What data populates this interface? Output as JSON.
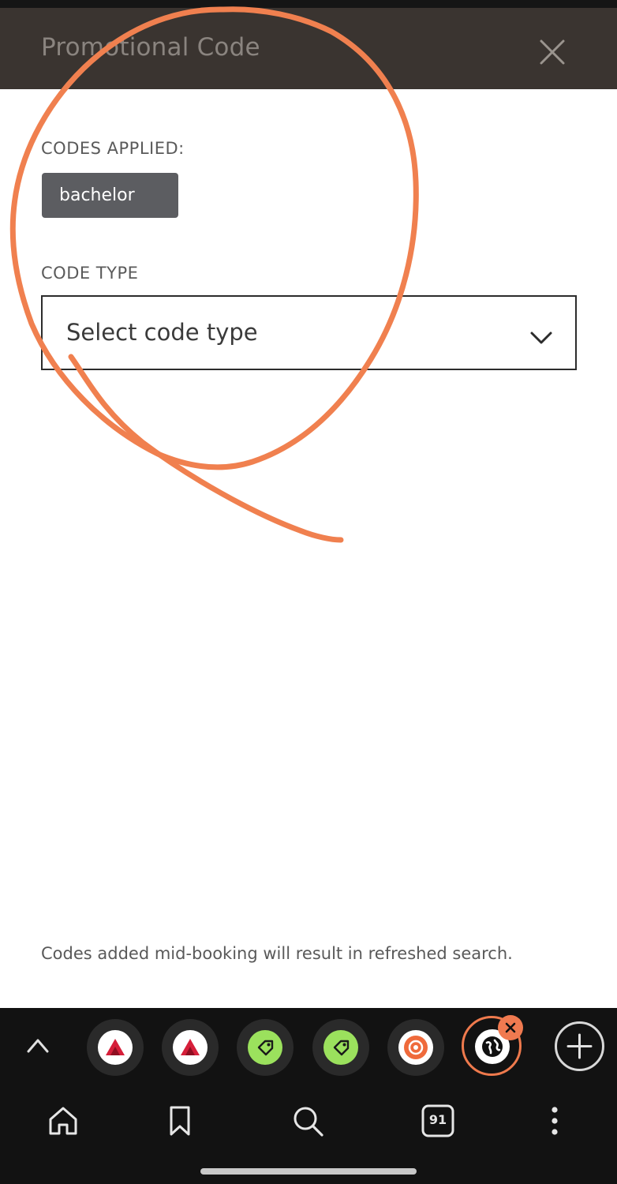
{
  "header": {
    "title": "Promotional Code",
    "close_icon": "close-icon"
  },
  "codes_applied": {
    "label": "CODES APPLIED:",
    "chips": [
      {
        "text": "bachelor",
        "remove_icon": "close-icon"
      }
    ]
  },
  "code_type": {
    "label": "CODE TYPE",
    "selected": "Select code type",
    "chevron_icon": "chevron-down-icon"
  },
  "footnote": "Codes added mid-booking will result in refreshed search.",
  "tab_bar": {
    "expand_icon": "chevron-up-icon",
    "tabs": [
      {
        "icon": "delta-icon"
      },
      {
        "icon": "delta-icon"
      },
      {
        "icon": "tag-icon"
      },
      {
        "icon": "tag-icon"
      },
      {
        "icon": "chip-icon"
      },
      {
        "icon": "globe-icon",
        "active": true
      }
    ],
    "new_tab_icon": "plus-icon"
  },
  "nav": {
    "tabs_count": "91",
    "items": [
      "home-icon",
      "bookmark-icon",
      "search-icon",
      "tabs-icon",
      "more-icon"
    ]
  },
  "colors": {
    "header_bg": "#3a3430",
    "chip_bg": "#5c5d61",
    "accent": "#ef7a4d",
    "bar_bg": "#121212"
  }
}
